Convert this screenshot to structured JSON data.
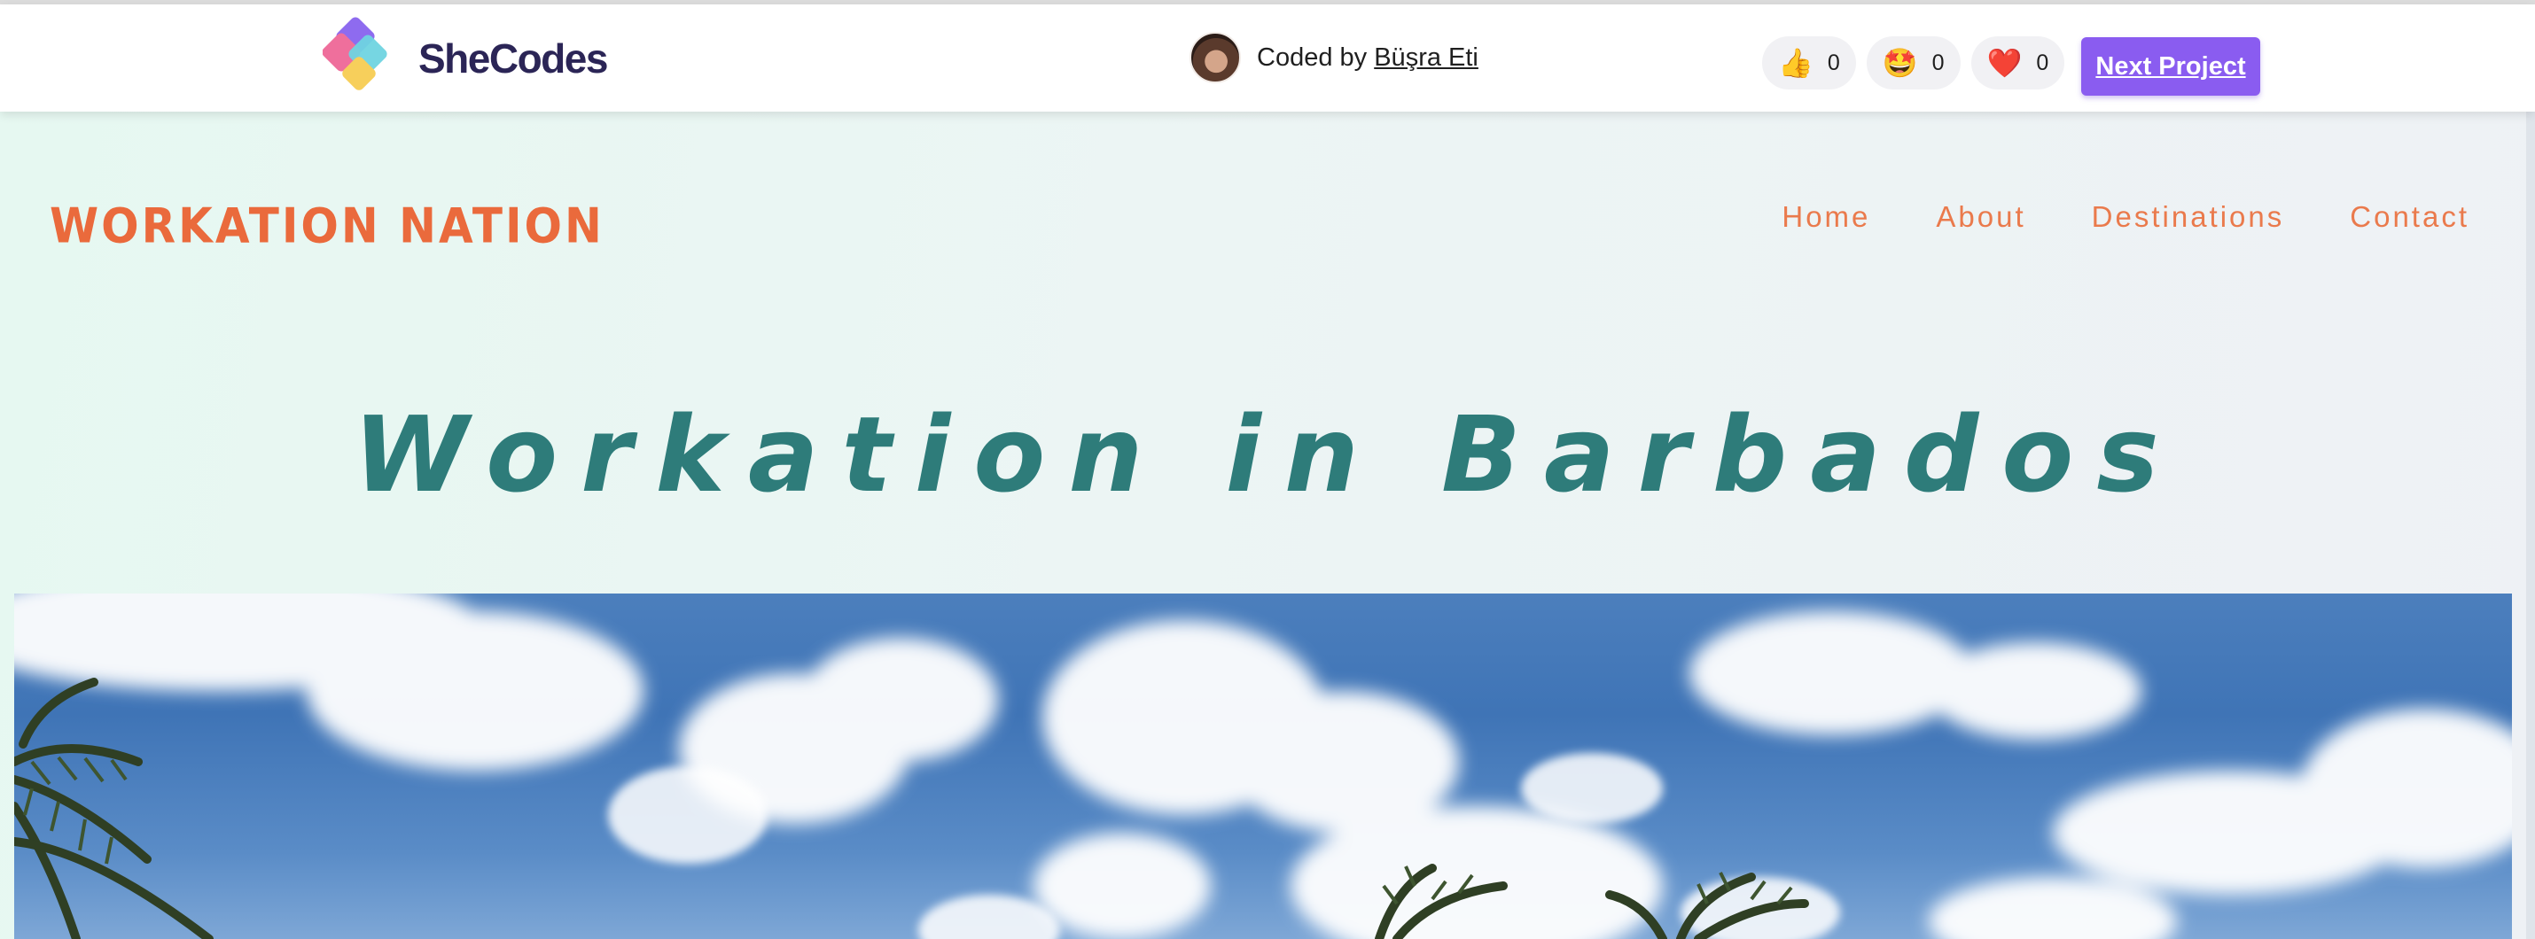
{
  "shecodes_bar": {
    "logo_text": "SheCodes",
    "coded_by_prefix": "Coded by",
    "author_name": "Büşra Eti",
    "reactions": [
      {
        "icon": "thumbs-up-icon",
        "emoji": "👍",
        "count": "0"
      },
      {
        "icon": "star-struck-icon",
        "emoji": "🤩",
        "count": "0"
      },
      {
        "icon": "heart-icon",
        "emoji": "❤️",
        "count": "0"
      }
    ],
    "next_project_label": "Next Project",
    "accent_color": "#8a5cf0"
  },
  "site": {
    "brand": "WORKATION NATION",
    "brand_color": "#ea6a3c",
    "nav": [
      {
        "label": "Home"
      },
      {
        "label": "About"
      },
      {
        "label": "Destinations"
      },
      {
        "label": "Contact"
      }
    ],
    "hero_title": "Workation in Barbados",
    "hero_title_color": "#2e7c7a",
    "hero_image": "sky-clouds-palm-trees"
  }
}
